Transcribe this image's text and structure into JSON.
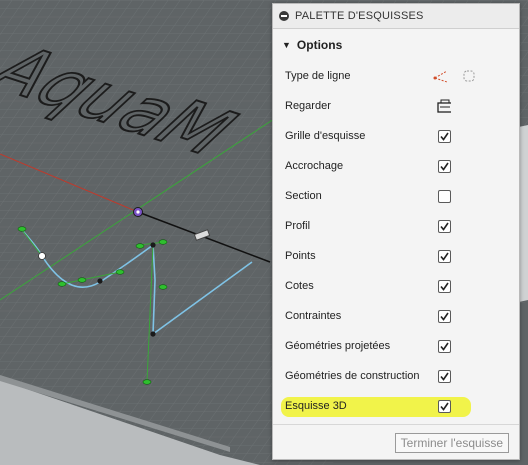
{
  "palette": {
    "title": "PALETTE D'ESQUISSES",
    "section_label": "Options",
    "rows": [
      {
        "label": "Type de ligne",
        "control": "icons"
      },
      {
        "label": "Regarder",
        "control": "icon"
      },
      {
        "label": "Grille d'esquisse",
        "control": "checkbox",
        "checked": true
      },
      {
        "label": "Accrochage",
        "control": "checkbox",
        "checked": true
      },
      {
        "label": "Section",
        "control": "checkbox",
        "checked": false
      },
      {
        "label": "Profil",
        "control": "checkbox",
        "checked": true
      },
      {
        "label": "Points",
        "control": "checkbox",
        "checked": true
      },
      {
        "label": "Cotes",
        "control": "checkbox",
        "checked": true
      },
      {
        "label": "Contraintes",
        "control": "checkbox",
        "checked": true
      },
      {
        "label": "Géométries projetées",
        "control": "checkbox",
        "checked": true
      },
      {
        "label": "Géométries de construction",
        "control": "checkbox",
        "checked": true
      },
      {
        "label": "Esquisse 3D",
        "control": "checkbox",
        "checked": true,
        "highlighted": true
      }
    ],
    "finish_button": "Terminer l'esquisse"
  },
  "viewport": {
    "embossed_text": "AquaM",
    "colors": {
      "grid": "#6b7072",
      "top_face": "#5f6466",
      "axis_red": "#c0392b",
      "axis_green": "#3aa63a",
      "curve": "#7fc3e6",
      "highlight": "#f1f34a"
    }
  }
}
